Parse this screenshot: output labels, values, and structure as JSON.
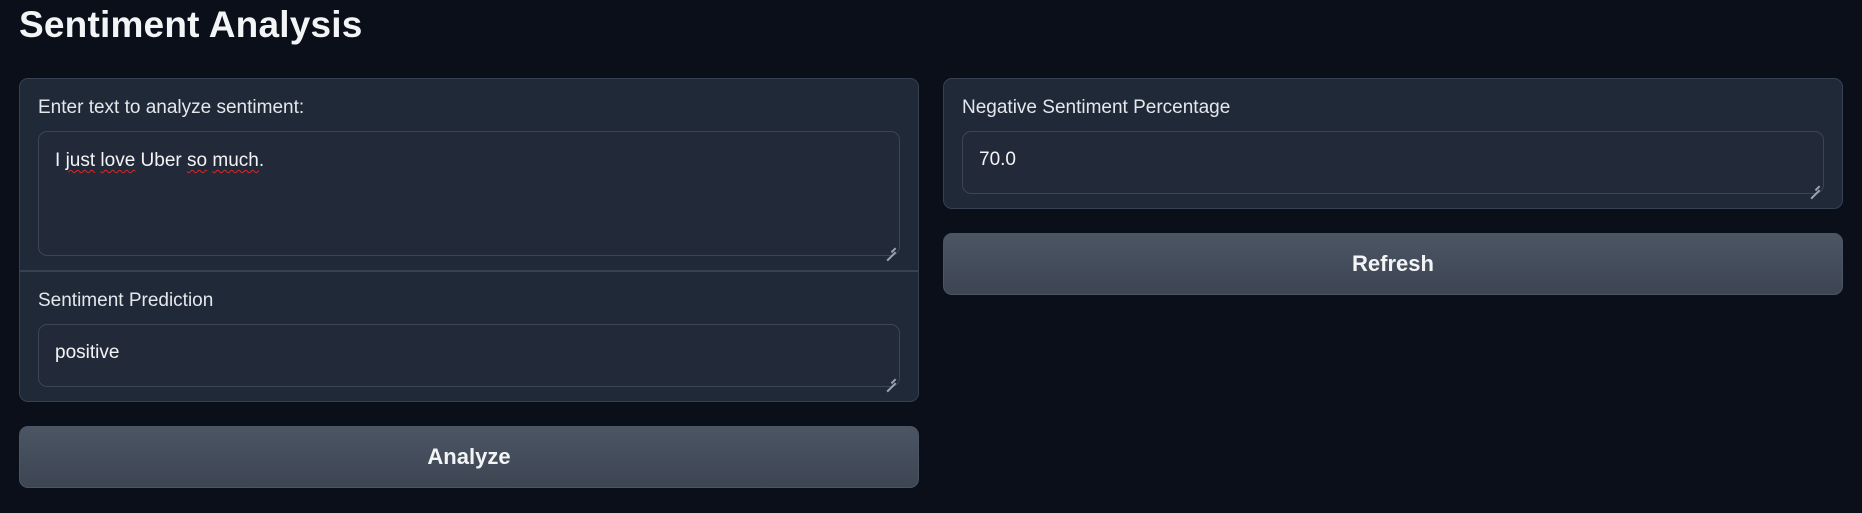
{
  "page": {
    "title": "Sentiment Analysis"
  },
  "input": {
    "label": "Enter text to analyze sentiment:",
    "value_parts": [
      "I ",
      "just",
      " ",
      "love",
      " Uber  ",
      "so",
      " ",
      "much",
      "."
    ]
  },
  "prediction": {
    "label": "Sentiment Prediction",
    "value": "positive"
  },
  "negative": {
    "label": "Negative Sentiment Percentage",
    "value": "70.0"
  },
  "buttons": {
    "analyze": "Analyze",
    "refresh": "Refresh"
  },
  "colors": {
    "background": "#0b0f19",
    "panel": "#1f2937",
    "button": "#4b5563",
    "spellcheck_underline": "#dc2626"
  }
}
